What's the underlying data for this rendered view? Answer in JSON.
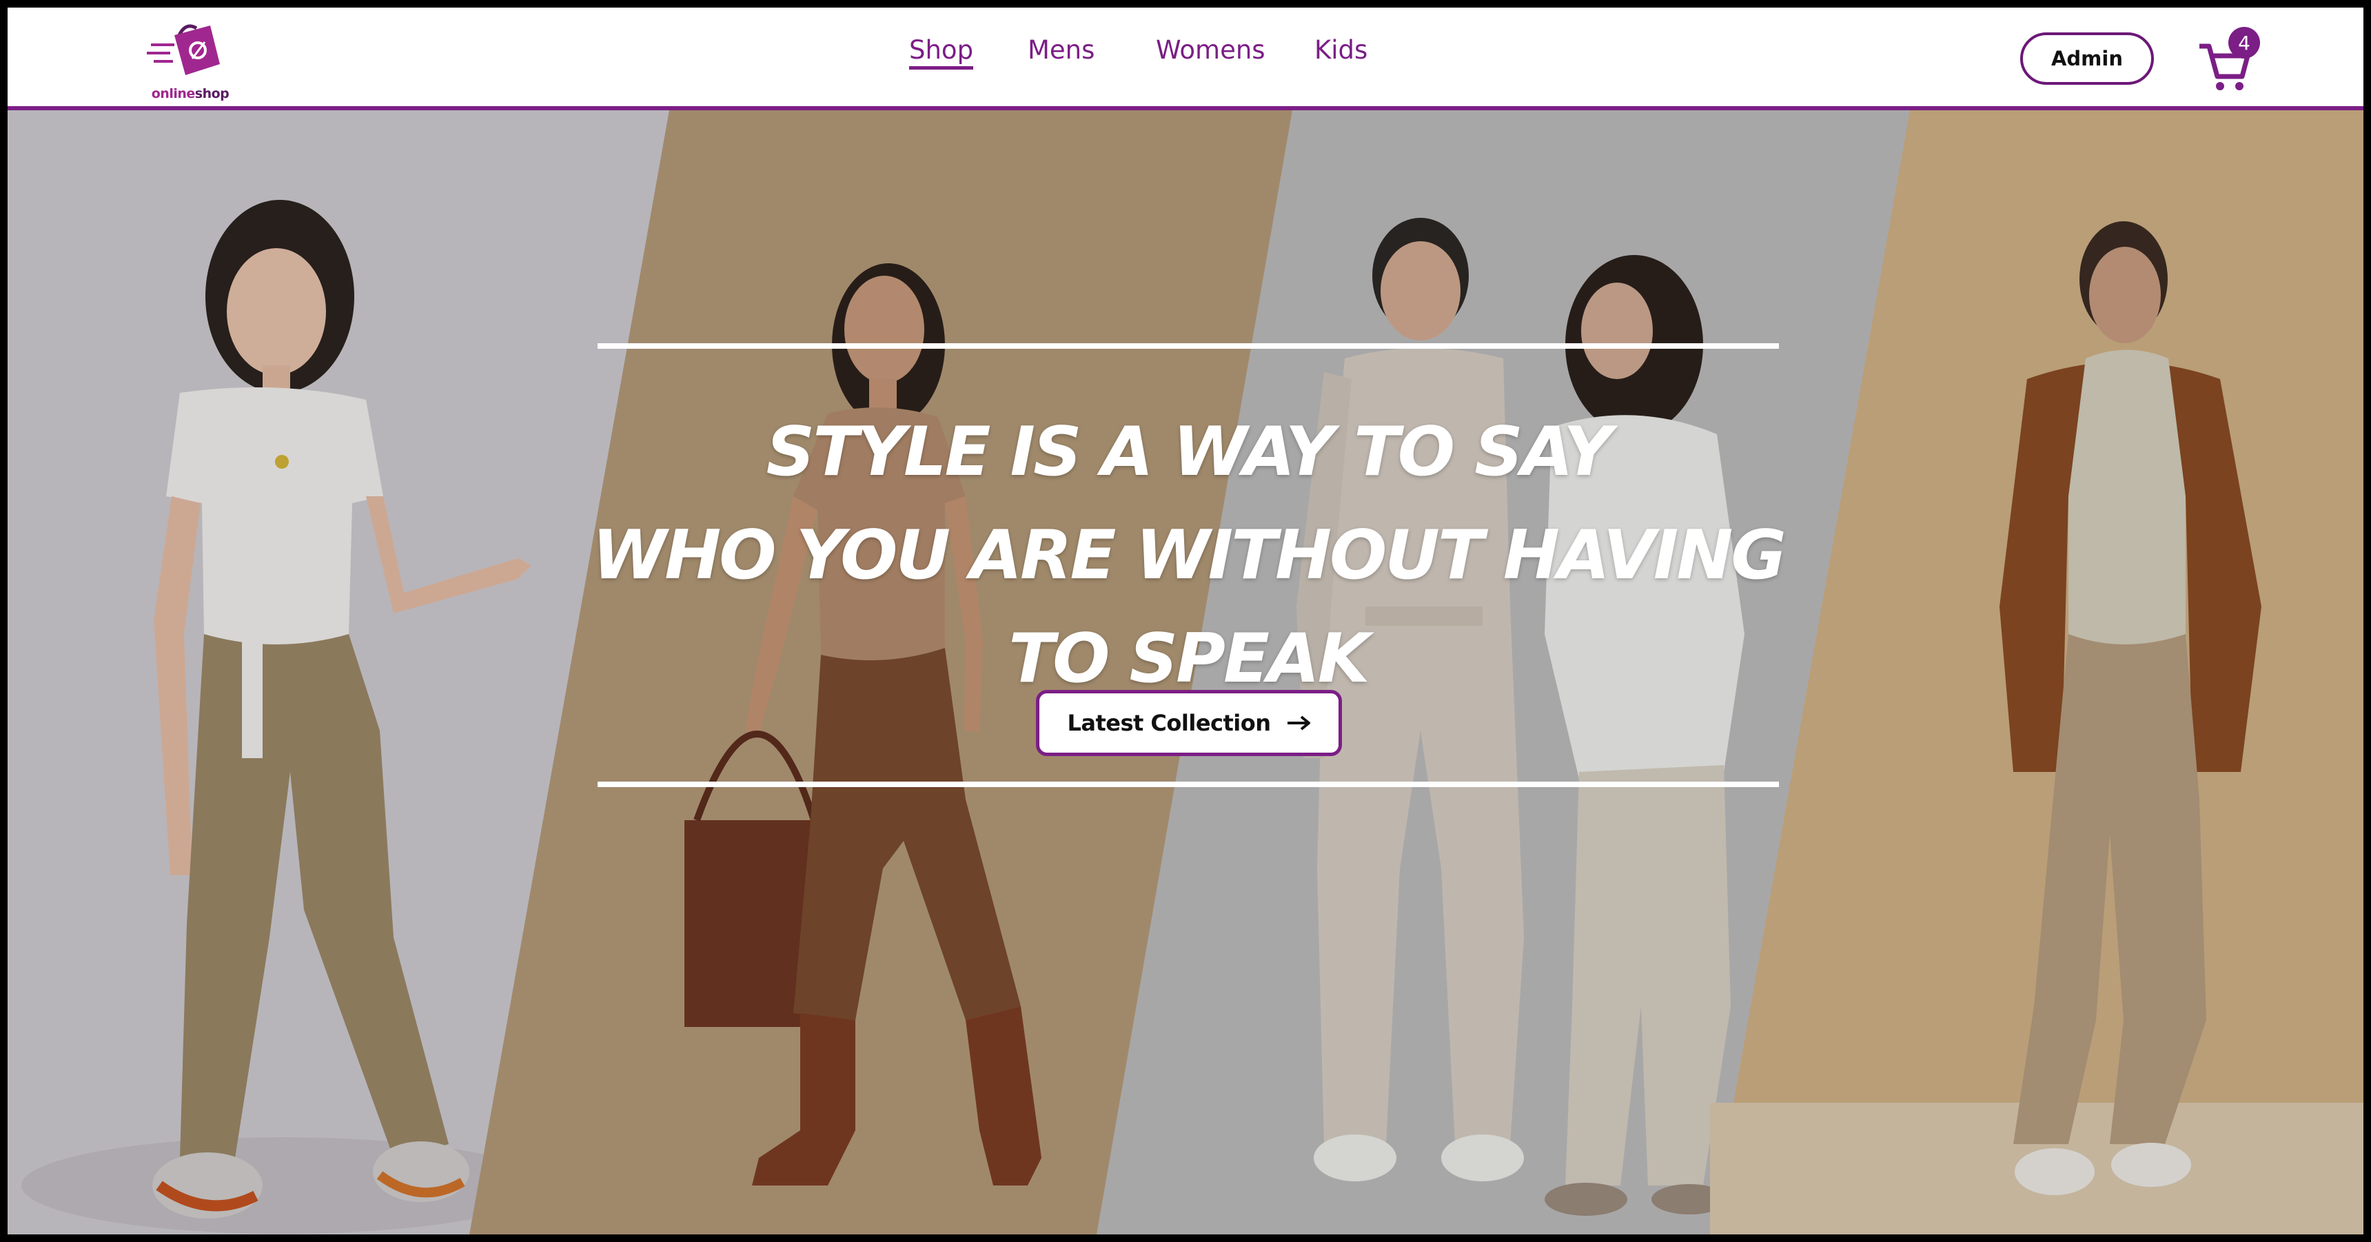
{
  "brand": {
    "logo_text_part1": "online",
    "logo_text_part2": "shop",
    "logo_icon": "shopping-bag-icon",
    "accent_color": "#7b1e86"
  },
  "nav": {
    "items": [
      {
        "label": "Shop",
        "active": true
      },
      {
        "label": "Mens",
        "active": false
      },
      {
        "label": "Womens",
        "active": false
      },
      {
        "label": "Kids",
        "active": false
      }
    ]
  },
  "header_actions": {
    "admin_label": "Admin",
    "cart_icon": "shopping-cart-icon",
    "cart_count": "4"
  },
  "hero": {
    "headline_lines": [
      "STYLE IS A WAY TO SAY",
      "WHO YOU ARE WITHOUT HAVING",
      "TO SPEAK"
    ],
    "cta_label": "Latest Collection",
    "cta_icon": "arrow-right-icon",
    "images": [
      {
        "name": "model-white-tee-cargo-pants",
        "background": "#cfccd2"
      },
      {
        "name": "model-beige-top-corduroy-pants",
        "background": "#b49a78"
      },
      {
        "name": "models-couple-white-outfits",
        "background": "#bdbcbd"
      },
      {
        "name": "model-rust-shirt-turtleneck",
        "background": "#d1b286"
      }
    ]
  }
}
